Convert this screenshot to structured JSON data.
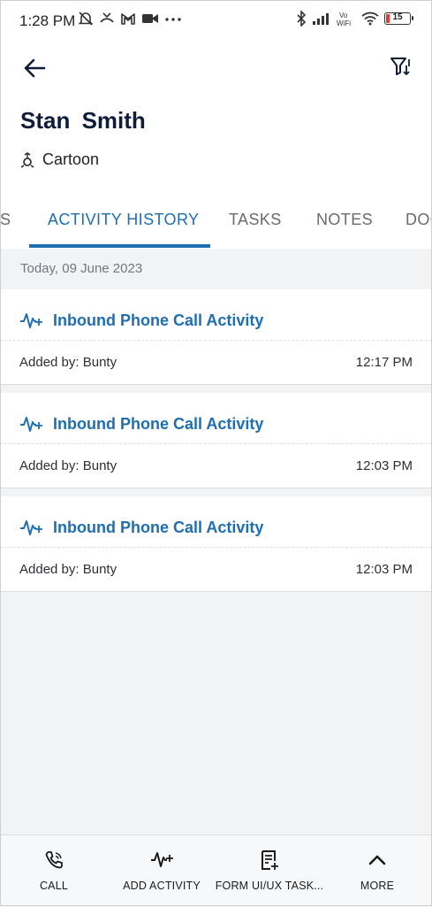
{
  "status_bar": {
    "time": "1:28 PM",
    "battery": "15"
  },
  "header": {
    "contact_name": "Stan  Smith",
    "contact_type": "Cartoon"
  },
  "tabs": [
    {
      "label": "S"
    },
    {
      "label": "ACTIVITY HISTORY",
      "active": true
    },
    {
      "label": "TASKS"
    },
    {
      "label": "NOTES"
    },
    {
      "label": "DOC"
    }
  ],
  "activity": {
    "date_header": "Today, 09 June 2023",
    "items": [
      {
        "title": "Inbound Phone Call Activity",
        "added_by": "Added by: Bunty",
        "time": "12:17 PM"
      },
      {
        "title": "Inbound Phone Call Activity",
        "added_by": "Added by: Bunty",
        "time": "12:03 PM"
      },
      {
        "title": "Inbound Phone Call Activity",
        "added_by": "Added by: Bunty",
        "time": "12:03 PM"
      }
    ]
  },
  "bottom_bar": [
    {
      "label": "CALL",
      "icon": "phone-icon"
    },
    {
      "label": "ADD ACTIVITY",
      "icon": "activity-plus-icon"
    },
    {
      "label": "FORM UI/UX TASK...",
      "icon": "form-add-icon"
    },
    {
      "label": "MORE",
      "icon": "chevron-up-icon"
    }
  ],
  "colors": {
    "accent": "#1d6fb1",
    "title_dark": "#0f1d3a",
    "background": "#f1f3f5"
  }
}
